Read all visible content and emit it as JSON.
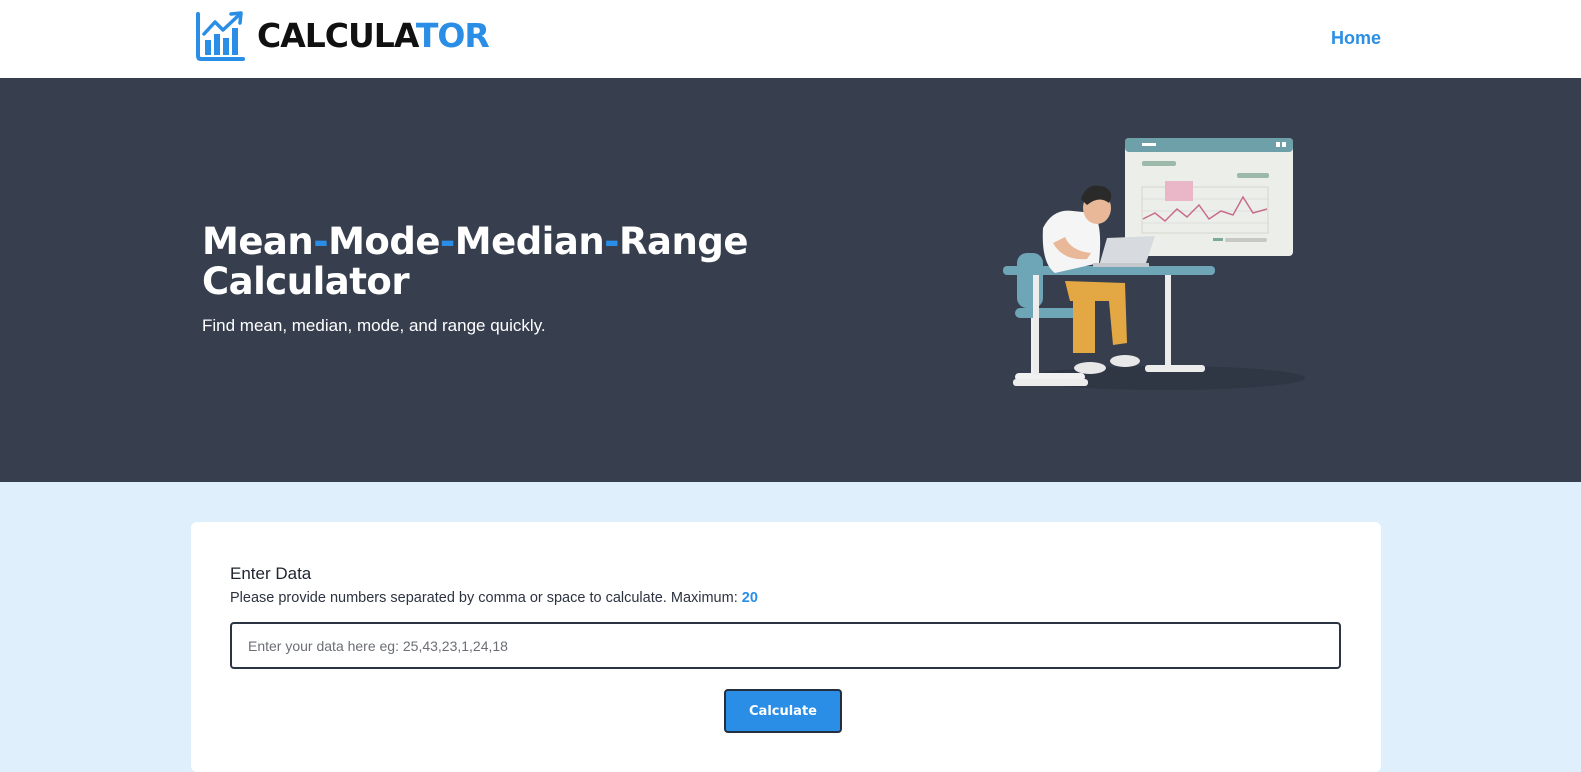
{
  "header": {
    "logo_text_dark": "CALCULA",
    "logo_text_blue": "TOR",
    "nav_home": "Home"
  },
  "hero": {
    "title_parts": [
      "Mean",
      "-",
      "Mode",
      "-",
      "Median",
      "-",
      "Range"
    ],
    "title_line2": "Calculator",
    "subtitle": "Find mean, median, mode, and range quickly."
  },
  "form": {
    "label": "Enter Data",
    "help_text": "Please provide numbers separated by comma or space to calculate. Maximum:",
    "max_value": "20",
    "input_placeholder": "Enter your data here eg: 25,43,23,1,24,18",
    "input_value": "",
    "button_label": "Calculate"
  },
  "colors": {
    "accent": "#2a8ee6",
    "hero_bg": "#373f4f",
    "page_bg": "#dff0fc"
  },
  "icons": [
    "chart-logo-icon"
  ]
}
